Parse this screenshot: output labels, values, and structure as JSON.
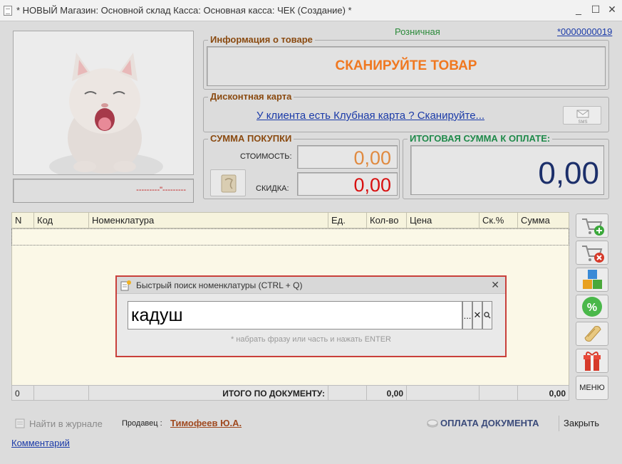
{
  "window": {
    "title": "* НОВЫЙ Магазин: Основной склад Касса: Основная касса: ЧЕК (Создание) *",
    "minimize": "_",
    "maximize": "☐",
    "close": "✕"
  },
  "header": {
    "price_type": "Розничная",
    "doc_number": "*0000000019"
  },
  "product_info": {
    "label": "Информация о товаре",
    "scan_prompt": "СКАНИРУЙТЕ ТОВАР"
  },
  "photo_caption": "---------\"---------",
  "discount_card": {
    "label": "Дисконтная карта",
    "link": "У клиента есть Клубная карта ? Сканируйте...",
    "sms_label": "SMS"
  },
  "purchase_sum": {
    "label": "СУММА ПОКУПКИ",
    "cost_label": "СТОИМОСТЬ:",
    "cost_value": "0,00",
    "discount_label": "СКИДКА:",
    "discount_value": "0,00"
  },
  "total_payment": {
    "label": "ИТОГОВАЯ СУММА К ОПЛАТЕ:",
    "value": "0,00"
  },
  "table": {
    "columns": [
      "N",
      "Код",
      "Номенклатура",
      "Ед.",
      "Кол-во",
      "Цена",
      "Ск.%",
      "Сумма"
    ],
    "footer": {
      "count": "0",
      "total_label": "ИТОГО ПО ДОКУМЕНТУ:",
      "qty_total": "0,00",
      "sum_total": "0,00"
    }
  },
  "side_menu": {
    "menu_label": "МЕНЮ"
  },
  "quick_search": {
    "title": "Быстрый поиск номенклатуры (CTRL + Q)",
    "value": "кадуш",
    "ellipsis_btn": "...",
    "clear_btn": "✕",
    "hint": "* набрать фразу или часть и нажать ENTER"
  },
  "footer": {
    "journal_link": "Найти в журнале",
    "seller_label": "Продавец :",
    "seller_name": "Тимофеев Ю.А.",
    "pay_button": "ОПЛАТА ДОКУМЕНТА",
    "close_button": "Закрыть",
    "comment_link": "Комментарий"
  },
  "colors": {
    "scan_orange": "#f07820",
    "cost_orange": "#e08a40",
    "discount_red": "#d81010",
    "total_navy": "#1c2f6a",
    "label_brown": "#8a4a10",
    "label_green": "#1f8a4a",
    "price_type_green": "#2b8a3a",
    "dialog_border": "#c9403b"
  }
}
